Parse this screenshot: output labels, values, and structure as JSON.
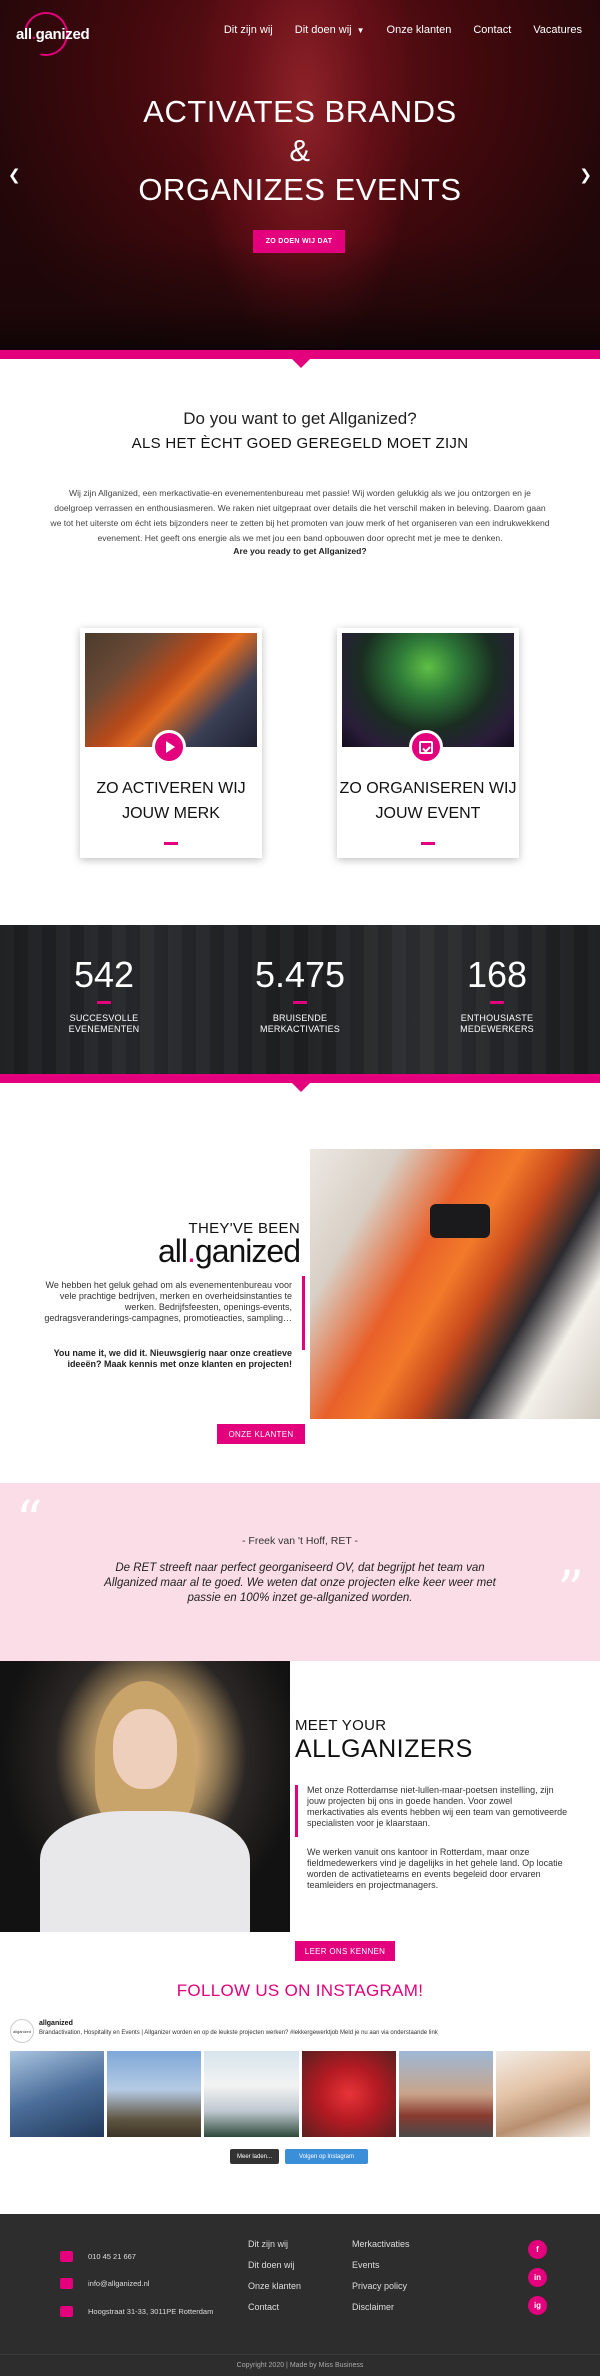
{
  "header": {
    "logo_text_1": "all",
    "logo_dot": ".",
    "logo_text_2": "ganized",
    "nav": [
      "Dit zijn wij",
      "Dit doen wij",
      "Onze klanten",
      "Contact",
      "Vacatures"
    ]
  },
  "hero": {
    "line1": "ACTIVATES BRANDS",
    "line2": "&",
    "line3": "ORGANIZES EVENTS",
    "cta": "ZO DOEN WIJ DAT"
  },
  "intro": {
    "question": "Do you want to get Allganized?",
    "subtitle": "ALS HET ÈCHT GOED GEREGELD MOET ZIJN",
    "body": "Wij zijn Allganized, een merkactivatie-en evenementenbureau met passie! Wij worden gelukkig als we jou ontzorgen en je doelgroep verrassen en enthousiasmeren. We raken niet uitgepraat over details die het verschil maken in beleving. Daarom gaan we tot het uiterste om écht iets bijzonders neer te zetten bij het promoten van jouw merk of het organiseren van een indrukwekkend evenement. Het geeft ons energie als we met jou een band opbouwen door oprecht met je mee te denken.",
    "ready": "Are you ready to get Allganized?"
  },
  "cards": [
    {
      "title_line1": "ZO ACTIVEREN WIJ",
      "title_line2": "JOUW MERK",
      "icon": "play-icon"
    },
    {
      "title_line1": "ZO ORGANISEREN WIJ",
      "title_line2": "JOUW EVENT",
      "icon": "calendar-check-icon"
    }
  ],
  "stats": [
    {
      "value": "542",
      "label_line1": "SUCCESVOLLE",
      "label_line2": "EVENEMENTEN"
    },
    {
      "value": "5.475",
      "label_line1": "BRUISENDE",
      "label_line2": "MERKACTIVATIES"
    },
    {
      "value": "168",
      "label_line1": "ENTHOUSIASTE",
      "label_line2": "MEDEWERKERS"
    }
  ],
  "clients": {
    "heading": "THEY'VE BEEN",
    "brand_1": "all",
    "brand_dot": ".",
    "brand_2": "ganized",
    "text": "We hebben het geluk gehad om als evenementenbureau voor vele prachtige bedrijven, merken en overheidsinstanties te werken. Bedrijfsfeesten, openings-events, gedragsveranderings-campagnes, promotieacties, sampling…",
    "text2": "You name it, we did it. Nieuwsgierig naar onze creatieve ideeën? Maak kennis met onze klanten en projecten!",
    "button": "ONZE KLANTEN"
  },
  "quote": {
    "author": "- Freek van 't Hoff, RET -",
    "text": "De RET streeft naar perfect georganiseerd OV, dat begrijpt het team van Allganized maar al te goed. We weten dat onze projecten elke keer weer met passie en 100% inzet ge-allganized worden."
  },
  "team": {
    "heading": "MEET YOUR",
    "title": "ALLGANIZERS",
    "text1": "Met onze Rotterdamse niet-lullen-maar-poetsen instelling, zijn jouw projecten bij ons in goede handen. Voor zowel merkactivaties als events hebben wij een team van gemotiveerde specialisten voor je klaarstaan.",
    "text2": "We werken vanuit ons kantoor in Rotterdam, maar onze fieldmedewerkers vind je dagelijks in het gehele land. Op locatie worden de activatieteams en events begeleid door ervaren teamleiders en projectmanagers.",
    "button": "LEER ONS KENNEN"
  },
  "instagram": {
    "heading": "FOLLOW US ON INSTAGRAM!",
    "avatar_text": "allganized",
    "handle": "allganized",
    "bio": "Brandactivation, Hospitality en Events  |  Allganizer worden en op de leukste projecten werken? #lekkergewerktjob Meld je nu aan via onderstaande link",
    "load_more": "Meer laden...",
    "follow": "Volgen op Instagram"
  },
  "footer": {
    "phone": "010 45 21 667",
    "email": "info@allganized.nl",
    "address": "Hoogstraat 31-33, 3011PE Rotterdam",
    "col1": [
      "Dit zijn wij",
      "Dit doen wij",
      "Onze klanten",
      "Contact"
    ],
    "col2": [
      "Merkactivaties",
      "Events",
      "Privacy policy",
      "Disclaimer"
    ],
    "social": [
      "f",
      "in",
      "ig"
    ],
    "copyright": "Copyright 2020 | Made by Miss Business"
  }
}
